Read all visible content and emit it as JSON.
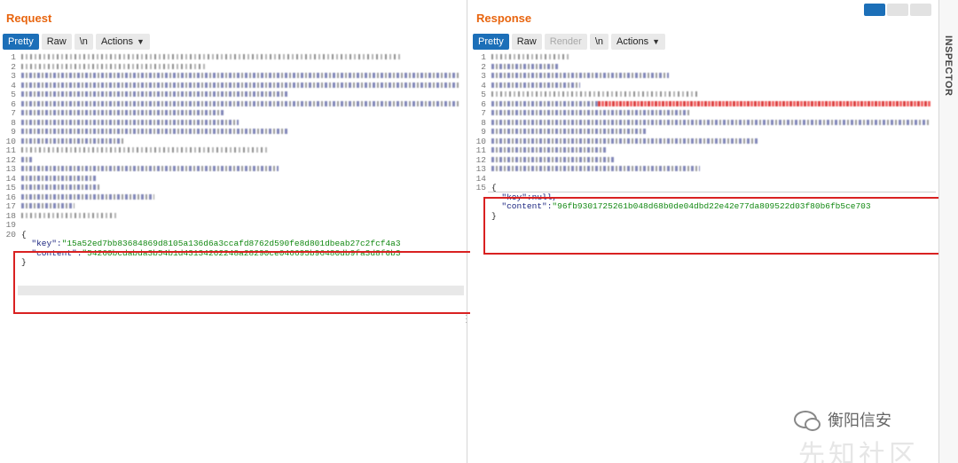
{
  "request": {
    "title": "Request",
    "toolbar": {
      "pretty": "Pretty",
      "raw": "Raw",
      "newline": "\\n",
      "actions": "Actions"
    },
    "line_numbers": [
      "1",
      "2",
      "3",
      "4",
      "5",
      "6",
      "7",
      "8",
      "9",
      "10",
      "11",
      "12",
      "13",
      "14",
      "15",
      "16",
      "17",
      "18",
      "19",
      "20"
    ],
    "body": {
      "open": "{",
      "key_name": "\"key\":",
      "key_value": "\"15a52ed7bb83684869d8105a136d6a3ccafd8762d590fe8d801dbeab27c2fcf4a3",
      "content_name": "\"content\":",
      "content_value": "\"54260bcdabda3b54b1d43134262248a28290ce046695b96480db9fa3d8f0b3",
      "close": "}"
    }
  },
  "response": {
    "title": "Response",
    "toolbar": {
      "pretty": "Pretty",
      "raw": "Raw",
      "render": "Render",
      "newline": "\\n",
      "actions": "Actions"
    },
    "line_numbers": [
      "1",
      "2",
      "3",
      "4",
      "5",
      "6",
      "7",
      "8",
      "9",
      "10",
      "11",
      "12",
      "13",
      "14",
      "15"
    ],
    "body": {
      "open": "{",
      "key_name": "\"key\":",
      "key_value": "null,",
      "content_name": "\"content\":",
      "content_value": "\"96fb9301725261b048d68b0de04dbd22e42e77da809522d03f80b6fb5ce703",
      "close": "}"
    }
  },
  "inspector": {
    "label": "INSPECTOR"
  },
  "watermark": {
    "text": "衡阳信安",
    "faint": "先知社区"
  },
  "colors": {
    "accent": "#e8650f",
    "active_button": "#1c6fb8",
    "highlight_box": "#d92121",
    "json_key": "#1c2680",
    "json_string": "#118811"
  }
}
